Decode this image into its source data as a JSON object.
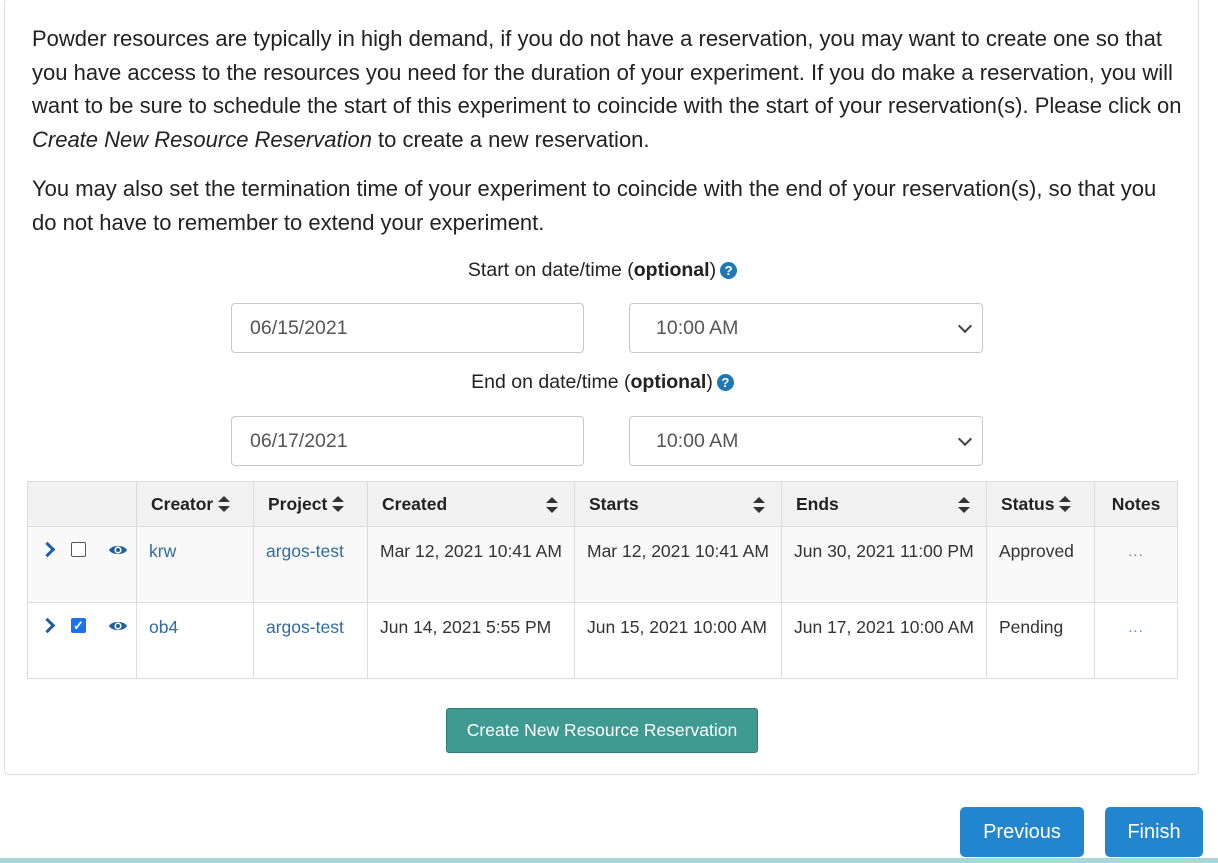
{
  "intro": {
    "p1_before": "Powder resources are typically in high demand, if you do not have a reservation, you may want to create one so that you have access to the resources you need for the duration of your experiment. If you do make a reservation, you will want to be sure to schedule the start of this experiment to coincide with the start of your reservation(s). Please click on ",
    "p1_emph": "Create New Resource Reservation",
    "p1_after": " to create a new reservation.",
    "p2": "You may also set the termination time of your experiment to coincide with the end of your reservation(s), so that you do not have to remember to extend your experiment."
  },
  "start": {
    "label": "Start on date/time (",
    "label_bold": "optional",
    "label_end": ")",
    "date": "06/15/2021",
    "time": "10:00 AM"
  },
  "end": {
    "label": "End on date/time (",
    "label_bold": "optional",
    "label_end": ")",
    "date": "06/17/2021",
    "time": "10:00 AM"
  },
  "help_glyph": "?",
  "table": {
    "headers": {
      "creator": "Creator",
      "project": "Project",
      "created": "Created",
      "starts": "Starts",
      "ends": "Ends",
      "status": "Status",
      "notes": "Notes"
    },
    "rows": [
      {
        "creator": "krw",
        "project": "argos-test",
        "created": "Mar 12, 2021 10:41 AM",
        "starts": "Mar 12, 2021 10:41 AM",
        "ends": "Jun 30, 2021 11:00 PM",
        "status": "Approved",
        "notes": "...",
        "checked": false
      },
      {
        "creator": "ob4",
        "project": "argos-test",
        "created": "Jun 14, 2021 5:55 PM",
        "starts": "Jun 15, 2021 10:00 AM",
        "ends": "Jun 17, 2021 10:00 AM",
        "status": "Pending",
        "notes": "...",
        "checked": true
      }
    ]
  },
  "buttons": {
    "create": "Create New Resource Reservation",
    "previous": "Previous",
    "finish": "Finish"
  },
  "colors": {
    "accent": "#2185d0",
    "create_button": "#3f9a92",
    "started": "#3a8a2e",
    "pending": "#e02020",
    "link": "#2e6da4"
  },
  "icons": {
    "expand": "chevron-right-icon",
    "view": "eye-icon",
    "help": "question-circle-icon",
    "sort": "sort-icon",
    "dropdown": "chevron-down-icon"
  }
}
